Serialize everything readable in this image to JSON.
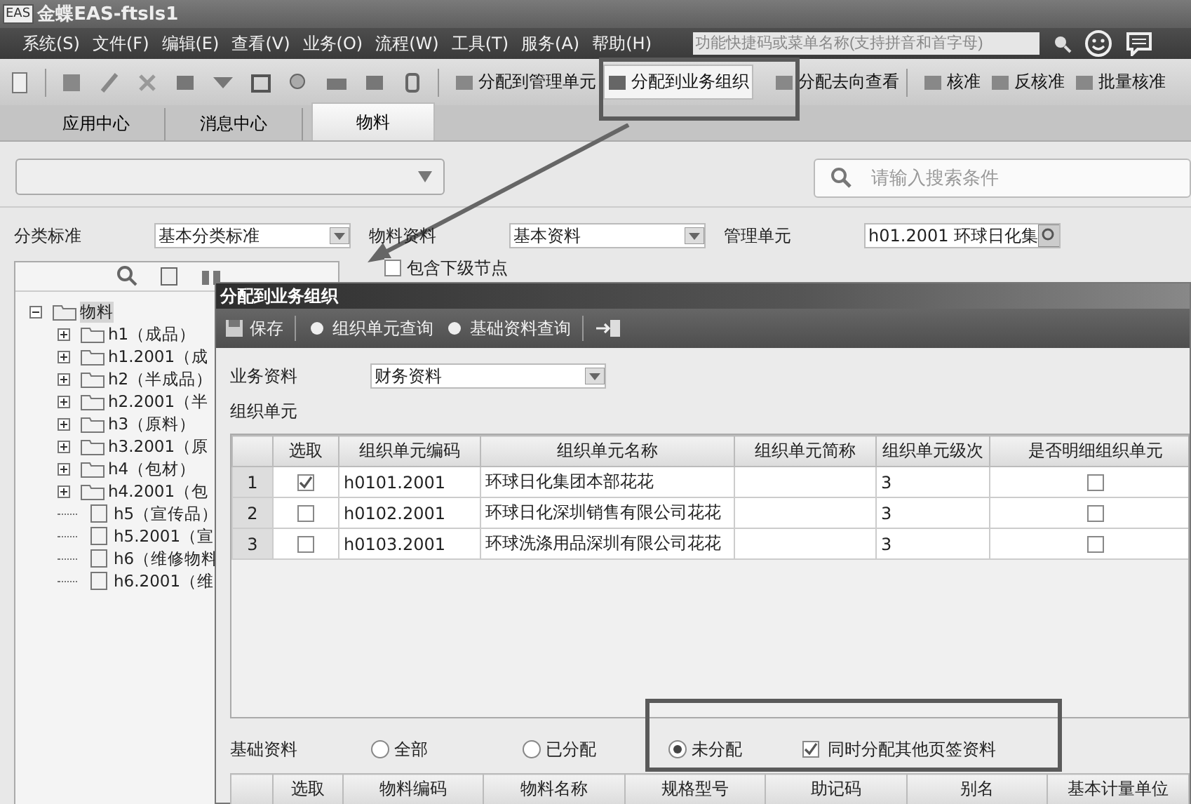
{
  "window": {
    "logo": "EAS",
    "title": "金蝶EAS-ftsls1"
  },
  "menu": [
    "系统(S)",
    "文件(F)",
    "编辑(E)",
    "查看(V)",
    "业务(O)",
    "流程(W)",
    "工具(T)",
    "服务(A)",
    "帮助(H)"
  ],
  "quick_search": {
    "placeholder": "功能快捷码或菜单名称(支持拼音和首字母)"
  },
  "toolbar": [
    {
      "label": "分配到管理单元",
      "selected": false
    },
    {
      "label": "分配到业务组织",
      "selected": true
    },
    {
      "label": "分配去向查看",
      "selected": false
    },
    {
      "label": "核准",
      "selected": false
    },
    {
      "label": "反核准",
      "selected": false
    },
    {
      "label": "批量核准",
      "selected": false
    }
  ],
  "tabs": [
    {
      "label": "应用中心",
      "selected": false
    },
    {
      "label": "消息中心",
      "selected": false
    },
    {
      "label": "物料",
      "selected": true
    }
  ],
  "search": {
    "placeholder": "请输入搜索条件"
  },
  "filters": [
    {
      "label": "分类标准",
      "value": "基本分类标准",
      "kind": "select"
    },
    {
      "label": "物料资料",
      "value": "基本资料",
      "kind": "select"
    },
    {
      "label": "管理单元",
      "value": "h01.2001 环球日化集",
      "kind": "lookup"
    }
  ],
  "include_children": {
    "label": "包含下级节点",
    "checked": false
  },
  "tree": {
    "label": "物料",
    "expanded": true,
    "selected": true,
    "children": [
      {
        "label": "h1（成品）",
        "kind": "folder",
        "selected": false
      },
      {
        "label": "h1.2001（成",
        "kind": "folder",
        "selected": false
      },
      {
        "label": "h2（半成品）",
        "kind": "folder",
        "selected": false
      },
      {
        "label": "h2.2001（半",
        "kind": "folder",
        "selected": false
      },
      {
        "label": "h3（原料）",
        "kind": "folder",
        "selected": false
      },
      {
        "label": "h3.2001（原",
        "kind": "folder",
        "selected": false
      },
      {
        "label": "h4（包材）",
        "kind": "folder",
        "selected": false
      },
      {
        "label": "h4.2001（包",
        "kind": "folder",
        "selected": false
      },
      {
        "label": "h5（宣传品）",
        "kind": "leaf",
        "selected": false
      },
      {
        "label": "h5.2001（宣",
        "kind": "leaf",
        "selected": false
      },
      {
        "label": "h6（维修物料",
        "kind": "leaf",
        "selected": false
      },
      {
        "label": "h6.2001（维",
        "kind": "leaf",
        "selected": false
      }
    ]
  },
  "dialog": {
    "title": "分配到业务组织",
    "toolbar": [
      {
        "label": "保存",
        "kind": "save"
      },
      {
        "label": "组织单元查询",
        "kind": "query"
      },
      {
        "label": "基础资料查询",
        "kind": "query"
      }
    ],
    "business_data": {
      "label": "业务资料",
      "value": "财务资料"
    },
    "org_units": {
      "title": "组织单元",
      "columns": [
        "选取",
        "组织单元编码",
        "组织单元名称",
        "组织单元简称",
        "组织单元级次",
        "是否明细组织单元"
      ],
      "rows": [
        {
          "index": "1",
          "selected": true,
          "code": "h0101.2001",
          "name": "环球日化集团本部花花",
          "level_no": "3",
          "is_detail": false
        },
        {
          "index": "2",
          "selected": false,
          "code": "h0102.2001",
          "name": "环球日化深圳销售有限公司花花",
          "level_no": "3",
          "is_detail": false
        },
        {
          "index": "3",
          "selected": false,
          "code": "h0103.2001",
          "name": "环球洗涤用品深圳有限公司花花",
          "level_no": "3",
          "is_detail": false
        }
      ]
    },
    "base_data": {
      "label": "基础资料",
      "options": [
        {
          "label": "全部",
          "selected": false
        },
        {
          "label": "已分配",
          "selected": false
        },
        {
          "label": "未分配",
          "selected": true
        }
      ],
      "also_assign": {
        "label": "同时分配其他页签资料",
        "checked": true
      }
    },
    "materials": {
      "columns": [
        "选取",
        "物料编码",
        "物料名称",
        "规格型号",
        "助记码",
        "别名",
        "基本计量单位"
      ]
    }
  }
}
